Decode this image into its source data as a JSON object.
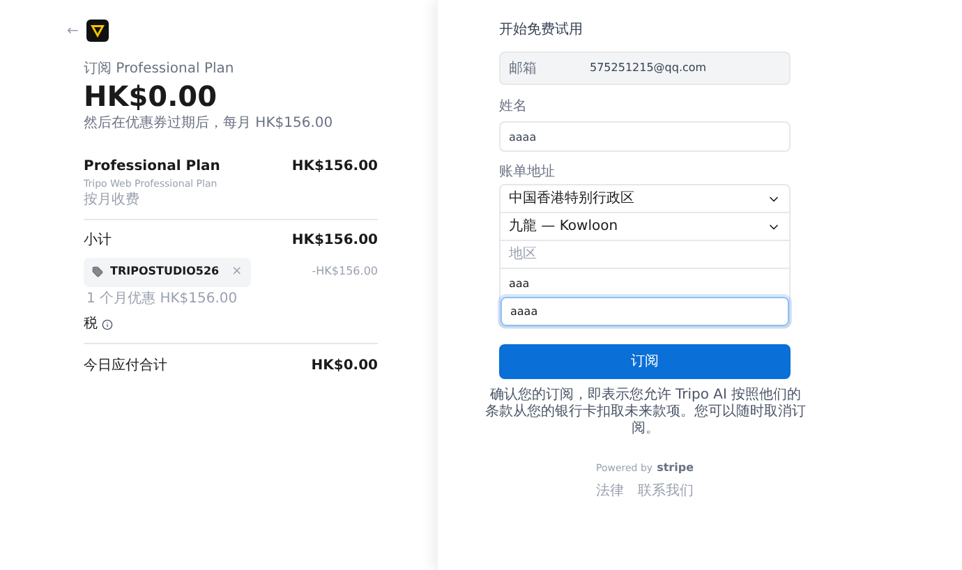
{
  "summary": {
    "back": "←",
    "title": "订阅 Professional Plan",
    "amount": "HK$0.00",
    "note": "然后在优惠券过期后，每月 HK$156.00"
  },
  "line_item": {
    "name": "Professional Plan",
    "price": "HK$156.00",
    "description": "Tripo Web Professional Plan",
    "billing": "按月收费"
  },
  "subtotal": {
    "label": "小计",
    "amount": "HK$156.00"
  },
  "coupon": {
    "code": "TRIPOSTUDIO526",
    "remove": "×",
    "discount": "-HK$156.00",
    "note": "1 个月优惠 HK$156.00"
  },
  "tax": {
    "label": "税"
  },
  "total": {
    "label": "今日应付合计",
    "amount": "HK$0.00"
  },
  "form": {
    "heading": "开始免费试用",
    "email_label": "邮箱",
    "email": "575251215@qq.com",
    "name_label": "姓名",
    "name": "aaaa",
    "address_label": "账单地址",
    "country": "中国香港特别行政区",
    "region": "九龍 — Kowloon",
    "district_placeholder": "地区",
    "line1": "aaa",
    "line2": "aaaa",
    "submit": "订阅",
    "consent": "确认您的订阅，即表示您允许 Tripo AI 按照他们的条款从您的银行卡扣取未来款项。您可以随时取消订阅。"
  },
  "footer": {
    "powered": "Powered by",
    "brand": "stripe",
    "links": [
      "法律",
      "联系我们"
    ]
  }
}
